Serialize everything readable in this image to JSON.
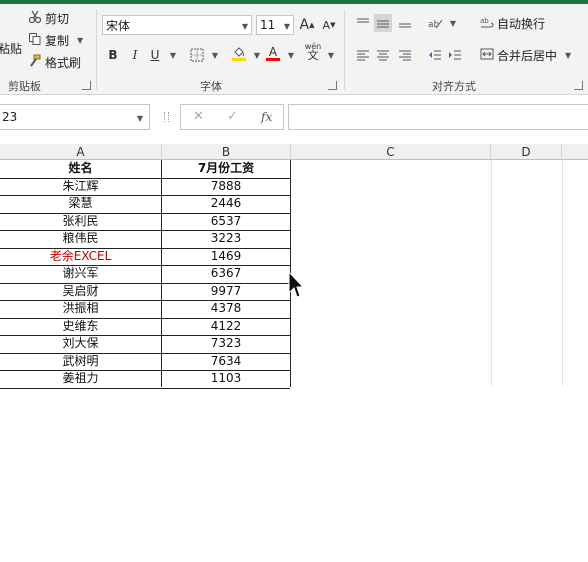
{
  "clipboard": {
    "paste_label": "粘贴",
    "cut_label": "剪切",
    "copy_label": "复制",
    "painter_label": "格式刷",
    "group_label": "剪贴板"
  },
  "font": {
    "name": "宋体",
    "size": "11",
    "grow": "A",
    "shrink": "A",
    "bold": "B",
    "italic": "I",
    "underline": "U",
    "font_color": "A",
    "wen": "wén",
    "wen_char": "文",
    "group_label": "字体"
  },
  "alignment": {
    "wrap_label": "自动换行",
    "merge_label": "合并后居中",
    "group_label": "对齐方式"
  },
  "formula_bar": {
    "name_box": "23",
    "fx": "fx",
    "value": ""
  },
  "columns": [
    "A",
    "B",
    "C",
    "D"
  ],
  "table": {
    "headers": [
      "姓名",
      "7月份工资"
    ],
    "rows": [
      {
        "name": "朱江辉",
        "salary": "7888"
      },
      {
        "name": "梁慧",
        "salary": "2446"
      },
      {
        "name": "张利民",
        "salary": "6537"
      },
      {
        "name": "粮伟民",
        "salary": "3223"
      },
      {
        "name": "老余EXCEL",
        "salary": "1469"
      },
      {
        "name": "谢兴军",
        "salary": "6367"
      },
      {
        "name": "吴启财",
        "salary": "9977"
      },
      {
        "name": "洪振相",
        "salary": "4378"
      },
      {
        "name": "史维东",
        "salary": "4122"
      },
      {
        "name": "刘大保",
        "salary": "7323"
      },
      {
        "name": "武树明",
        "salary": "7634"
      },
      {
        "name": "姜祖力",
        "salary": "1103"
      }
    ]
  },
  "colors": {
    "accent": "#217346",
    "highlight_red": "#c00000",
    "fill_yellow": "#ffd700",
    "font_red": "#ff0000"
  }
}
